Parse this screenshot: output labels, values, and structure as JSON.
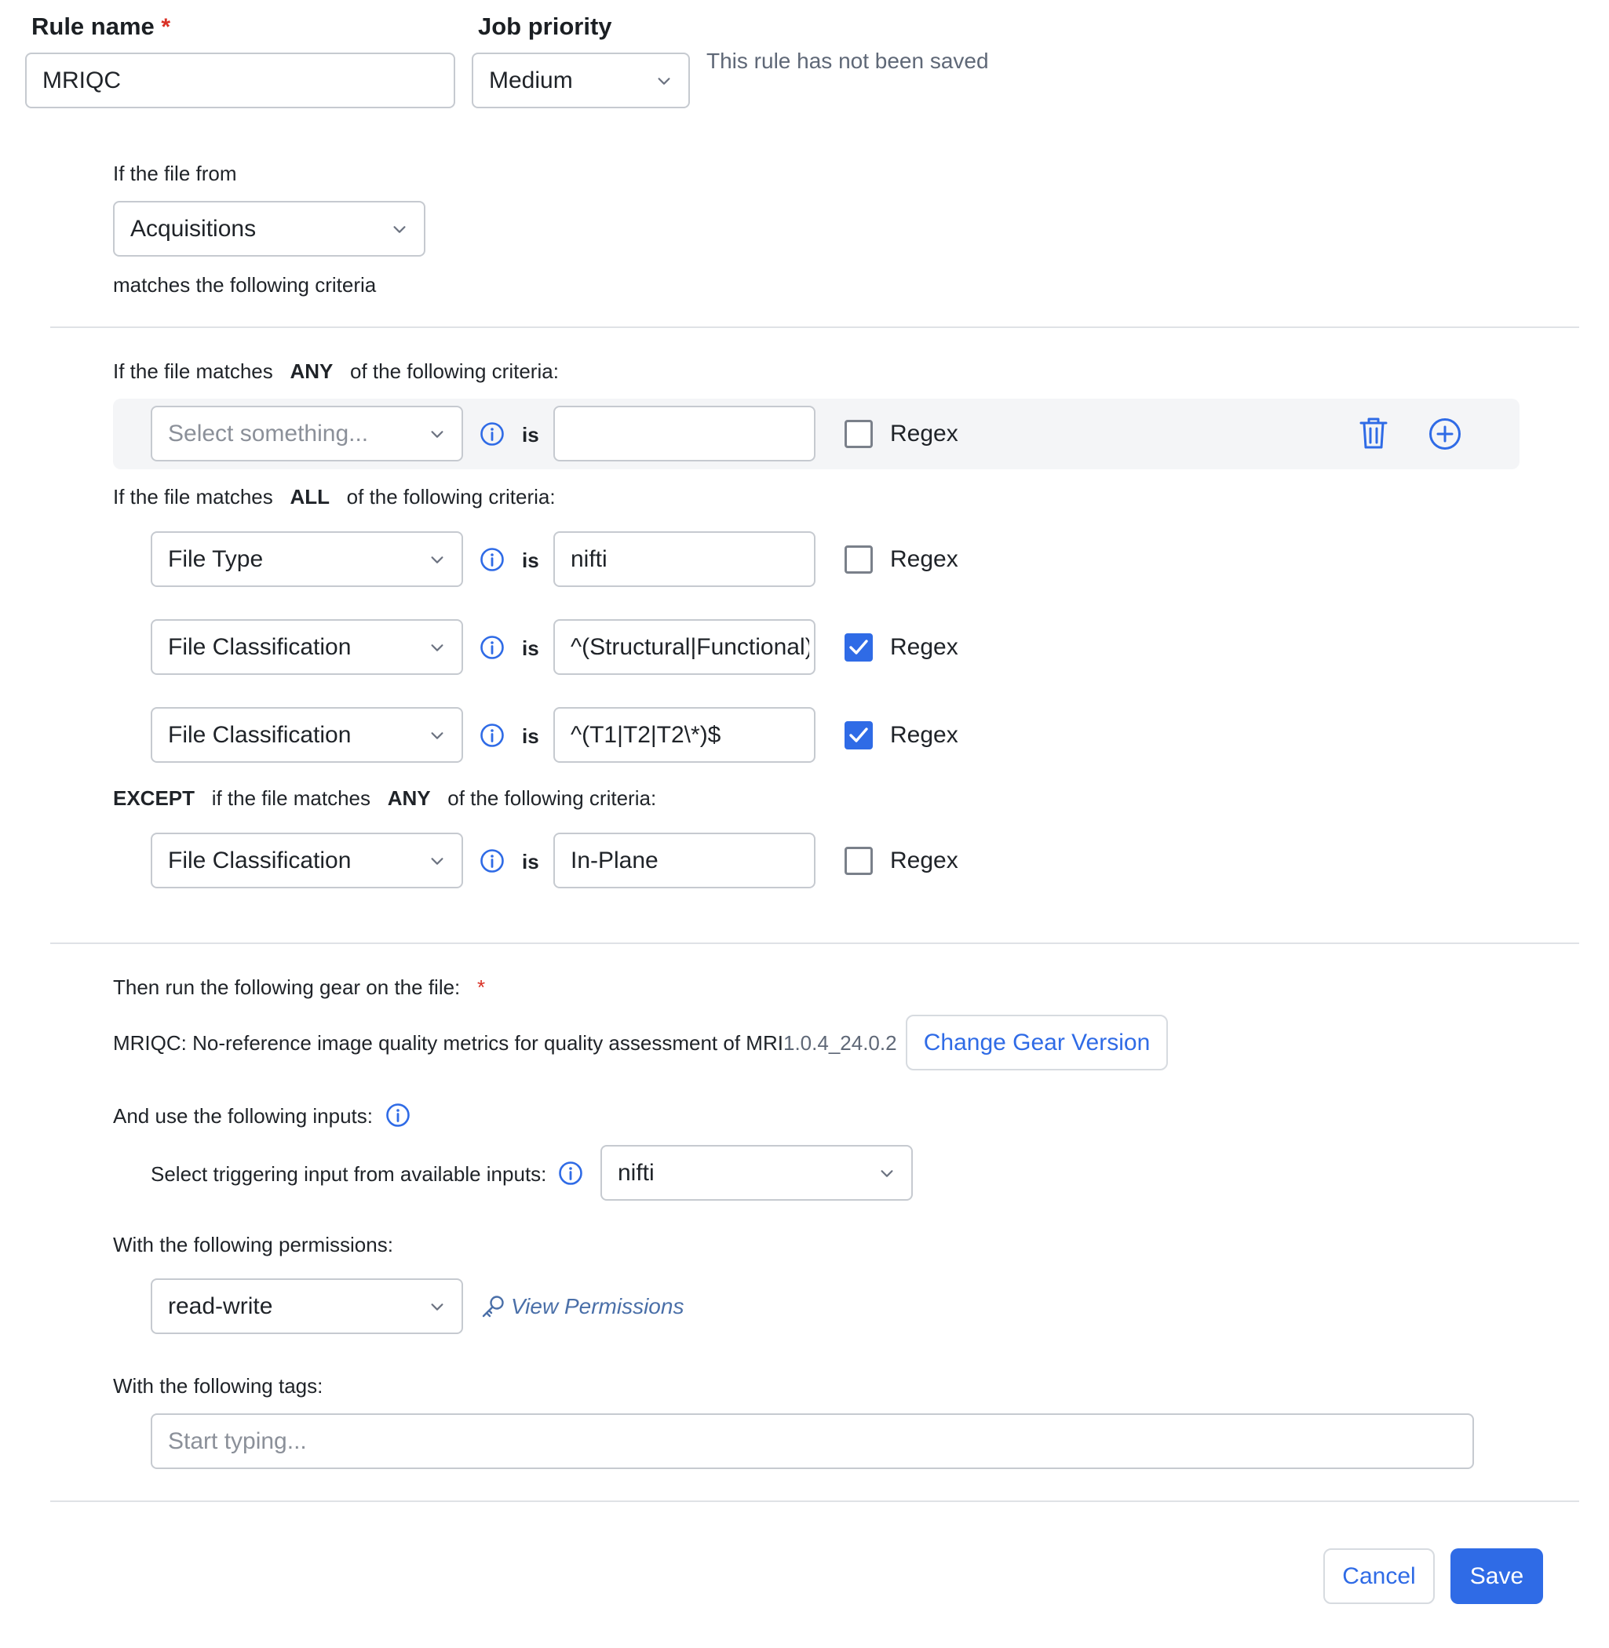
{
  "header": {
    "rule_name_label": "Rule name",
    "rule_name_required": "*",
    "rule_name_value": "MRIQC",
    "job_priority_label": "Job priority",
    "job_priority_value": "Medium",
    "unsaved_notice": "This rule has not been saved"
  },
  "source": {
    "label": "If the file from",
    "value": "Acquisitions",
    "suffix": "matches the following criteria"
  },
  "any_section": {
    "prefix": "If the file matches",
    "keyword": "ANY",
    "suffix": "of the following criteria:",
    "rows": [
      {
        "field_placeholder": "Select something...",
        "is_label": "is",
        "value": "",
        "regex_label": "Regex",
        "regex_checked": false
      }
    ]
  },
  "all_section": {
    "prefix": "If the file matches",
    "keyword": "ALL",
    "suffix": "of the following criteria:",
    "rows": [
      {
        "field": "File Type",
        "is_label": "is",
        "value": "nifti",
        "regex_label": "Regex",
        "regex_checked": false
      },
      {
        "field": "File Classification",
        "is_label": "is",
        "value": "^(Structural|Functional)$",
        "regex_label": "Regex",
        "regex_checked": true
      },
      {
        "field": "File Classification",
        "is_label": "is",
        "value": "^(T1|T2|T2\\*)$",
        "regex_label": "Regex",
        "regex_checked": true
      }
    ]
  },
  "except_section": {
    "except_keyword": "EXCEPT",
    "prefix": "if the file matches",
    "keyword": "ANY",
    "suffix": "of the following criteria:",
    "rows": [
      {
        "field": "File Classification",
        "is_label": "is",
        "value": "In-Plane",
        "regex_label": "Regex",
        "regex_checked": false
      }
    ]
  },
  "gear": {
    "label": "Then run the following gear on the file:",
    "required": "*",
    "name": "MRIQC: No-reference image quality metrics for quality assessment of MRI",
    "version": "1.0.4_24.0.2",
    "change_button": "Change Gear Version"
  },
  "inputs": {
    "label": "And use the following inputs:",
    "trigger_label": "Select triggering input from available inputs:",
    "trigger_value": "nifti"
  },
  "permissions": {
    "label": "With the following permissions:",
    "value": "read-write",
    "view_link": "View Permissions"
  },
  "tags": {
    "label": "With the following tags:",
    "placeholder": "Start typing..."
  },
  "footer": {
    "cancel": "Cancel",
    "save": "Save"
  },
  "icons": {
    "chevron": "chevron-down-icon",
    "info": "info-icon",
    "trash": "trash-icon",
    "add": "plus-circle-icon",
    "key": "key-icon",
    "check": "check-icon"
  },
  "colors": {
    "accent": "#2f6be6",
    "required": "#d93025",
    "border": "#c6cad0",
    "link_muted": "#4a6fa8"
  }
}
